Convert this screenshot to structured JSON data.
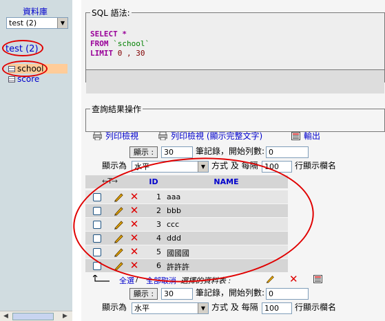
{
  "nav": {
    "db_title": "資料庫",
    "db_select_value": "test (2)",
    "db_link": "test (2)",
    "tables": [
      {
        "name": "school"
      },
      {
        "name": "score"
      }
    ]
  },
  "sql": {
    "legend": "SQL 語法:",
    "select_kw": "SELECT",
    "select_rest": " *",
    "from_kw": "FROM",
    "from_table": " `school`",
    "limit_kw": "LIMIT",
    "limit_vals": " 0 , 30"
  },
  "ops": {
    "legend": "查詢結果操作",
    "print_view": "列印檢視",
    "print_full": "列印檢視 (顯示完整文字)",
    "export": "輸出"
  },
  "nav_controls_top": {
    "show_button": "顯示 :",
    "rows_value": "30",
    "records_label": "筆記錄，開始列數:",
    "start_value": "0",
    "display_as_label": "顯示為",
    "mode_value": "水平",
    "mode_label": "方式 及 每隔",
    "repeat_value": "100",
    "repeat_label": "行顯示欄名"
  },
  "table": {
    "sort_arrows": "←T→",
    "col_id": "ID",
    "col_name": "NAME",
    "rows": [
      {
        "id": "1",
        "name": "aaa"
      },
      {
        "id": "2",
        "name": "bbb"
      },
      {
        "id": "3",
        "name": "ccc"
      },
      {
        "id": "4",
        "name": "ddd"
      },
      {
        "id": "5",
        "name": "國國國"
      },
      {
        "id": "6",
        "name": "許許許"
      }
    ]
  },
  "bottom": {
    "select_all": "全選",
    "slash": " / ",
    "deselect_all": "全部取消",
    "selected_label": "選擇的資料表 :"
  },
  "nav_controls_bottom": {
    "show_button": "顯示 :",
    "rows_value": "30",
    "records_label": "筆記錄，開始列數:",
    "start_value": "0",
    "display_as_label": "顯示為",
    "mode_value": "水平",
    "mode_label": "方式 及 每隔",
    "repeat_value": "100",
    "repeat_label": "行顯示欄名"
  },
  "colors": {
    "nav_bg": "#d0dce0",
    "link": "#0000cc",
    "highlight": "#ffcc99",
    "annotation_red": "#e00000"
  }
}
